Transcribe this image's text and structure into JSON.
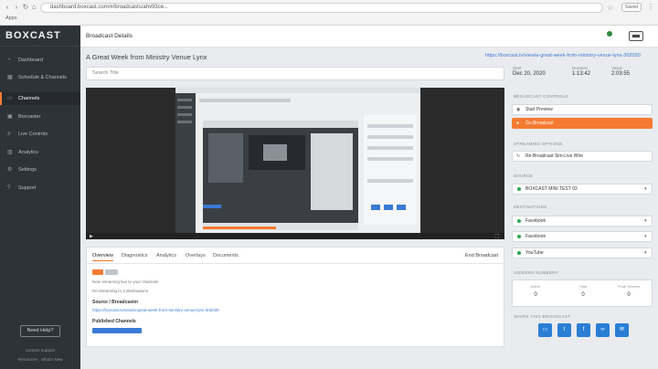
{
  "browser": {
    "url": "dashboard.boxcast.com/#/broadcasts/ahv93ce...",
    "apps_label": "Apps",
    "ext_label": "Saved"
  },
  "sidebar": {
    "logo": "BOXCAST",
    "items": [
      {
        "label": "Dashboard",
        "icon": "gauge-icon"
      },
      {
        "label": "Schedule & Channels",
        "icon": "calendar-icon"
      },
      {
        "label": "Channels",
        "icon": "channels-icon"
      },
      {
        "label": "Boxcaster",
        "icon": "boxcaster-icon"
      },
      {
        "label": "Live Controls",
        "icon": "sliders-icon"
      },
      {
        "label": "Analytics",
        "icon": "chart-icon"
      },
      {
        "label": "Settings",
        "icon": "gear-icon"
      },
      {
        "label": "Support",
        "icon": "help-icon"
      }
    ],
    "active_index": 2,
    "need_help": "Need Help?",
    "footer_line1": "Contact Support",
    "footer_line2": "Resources · What's New"
  },
  "header": {
    "title": "Broadcast Details"
  },
  "main": {
    "event_title": "A Great Week from Ministry Venue Lynx",
    "share_link": "https://boxcast.tv/view/a-great-week-from-ministry-venue-lynx-302030",
    "search_placeholder": "Search Title",
    "stats": [
      {
        "label": "Start",
        "value": "Dec 20, 2020"
      },
      {
        "label": "Duration",
        "value": "1:13:42"
      },
      {
        "label": "Views",
        "value": "2:03:55"
      }
    ],
    "tabs": [
      "Overview",
      "Diagnostics",
      "Analytics",
      "Overlays",
      "Documents"
    ],
    "active_tab": 0,
    "end_broadcast": "End Broadcast",
    "overview_lines": [
      "Now streaming live to your channels",
      "Re-streaming to 3 destinations"
    ],
    "source_head": "Source / Broadcaster",
    "source_link": "https://boxcast.tv/view/a-great-week-from-ministry-venue-lynx-302030",
    "published_head": "Published Channels"
  },
  "right": {
    "broadcast_control_label": "BROADCAST CONTROLS",
    "start_preview": "Start Preview",
    "go_live": "Go Broadcast",
    "streaming_label": "STREAMING OPTIONS",
    "stream_option": "Re-Broadcast Sim-Live Wire",
    "source_label": "SOURCE",
    "source_value": "BOXCAST MINI TEST 03",
    "destinations_label": "DESTINATIONS",
    "destinations": [
      "Facebook",
      "Facebook",
      "YouTube"
    ],
    "viewers_label": "VIEWERS NUMBERS",
    "viewers": [
      {
        "label": "Active",
        "value": "0"
      },
      {
        "label": "Total",
        "value": "0"
      },
      {
        "label": "Peak Viewers",
        "value": "0"
      }
    ],
    "share_label": "SHARE THIS BROADCAST",
    "share_icons": [
      "embed-icon",
      "twitter-icon",
      "facebook-icon",
      "link-icon",
      "email-icon"
    ]
  }
}
